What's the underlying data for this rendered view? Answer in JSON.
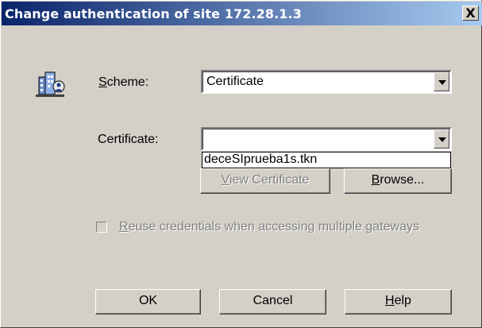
{
  "window": {
    "title": "Change authentication of site 172.28.1.3",
    "close_label": "X"
  },
  "scheme": {
    "label_prefix": "",
    "label_mnemonic": "S",
    "label_rest": "cheme:",
    "selected": "Certificate"
  },
  "certificate": {
    "label": "Certificate:",
    "selected": "",
    "dropdown_items": [
      "deceSIprueba1s.tkn"
    ]
  },
  "buttons": {
    "view_certificate_mnemonic": "V",
    "view_certificate_rest": "iew Certificate",
    "browse_mnemonic": "B",
    "browse_rest": "rowse...",
    "ok": "OK",
    "cancel": "Cancel",
    "help_mnemonic": "H",
    "help_rest": "elp"
  },
  "reuse": {
    "label_mnemonic": "R",
    "label_rest": "euse credentials when accessing multiple gateways",
    "checked": false
  },
  "icons": {
    "site_icon": "network-site-icon",
    "combo_arrow": "chevron-down-icon"
  }
}
